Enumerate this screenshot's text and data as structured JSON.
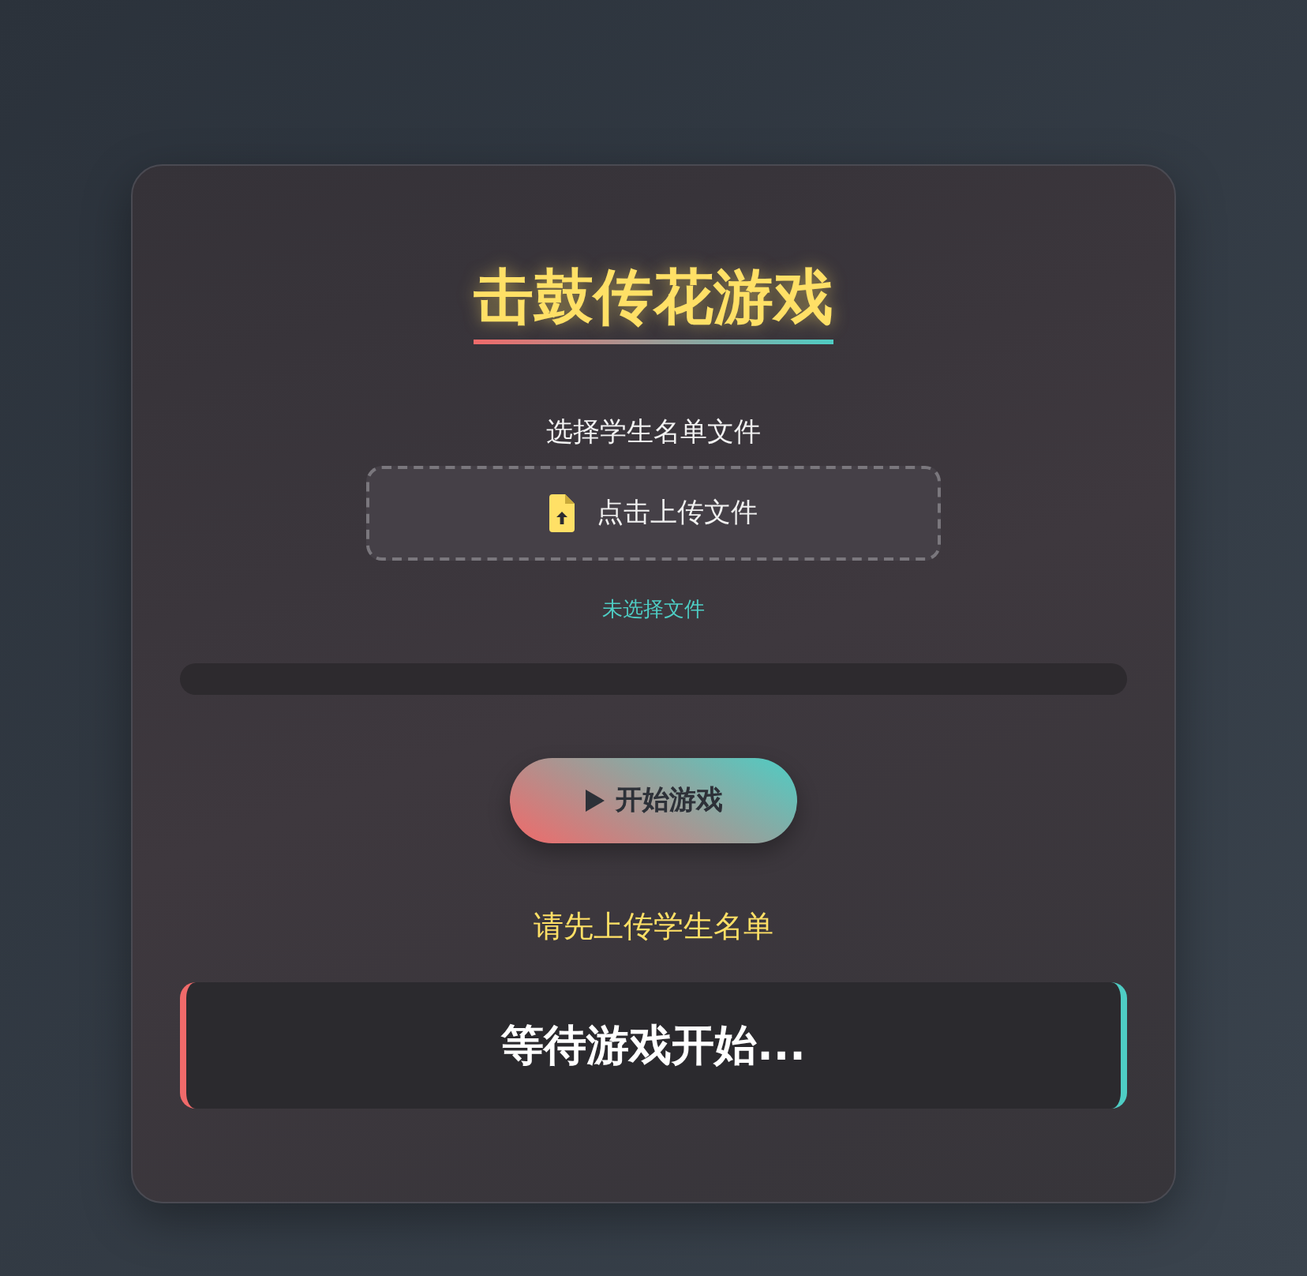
{
  "title": "击鼓传花游戏",
  "upload": {
    "label": "选择学生名单文件",
    "button": "点击上传文件",
    "file_status": "未选择文件"
  },
  "progress": {
    "level": 0
  },
  "start_button": {
    "label": "开始游戏"
  },
  "message": "请先上传学生名单",
  "display": "等待游戏开始..."
}
